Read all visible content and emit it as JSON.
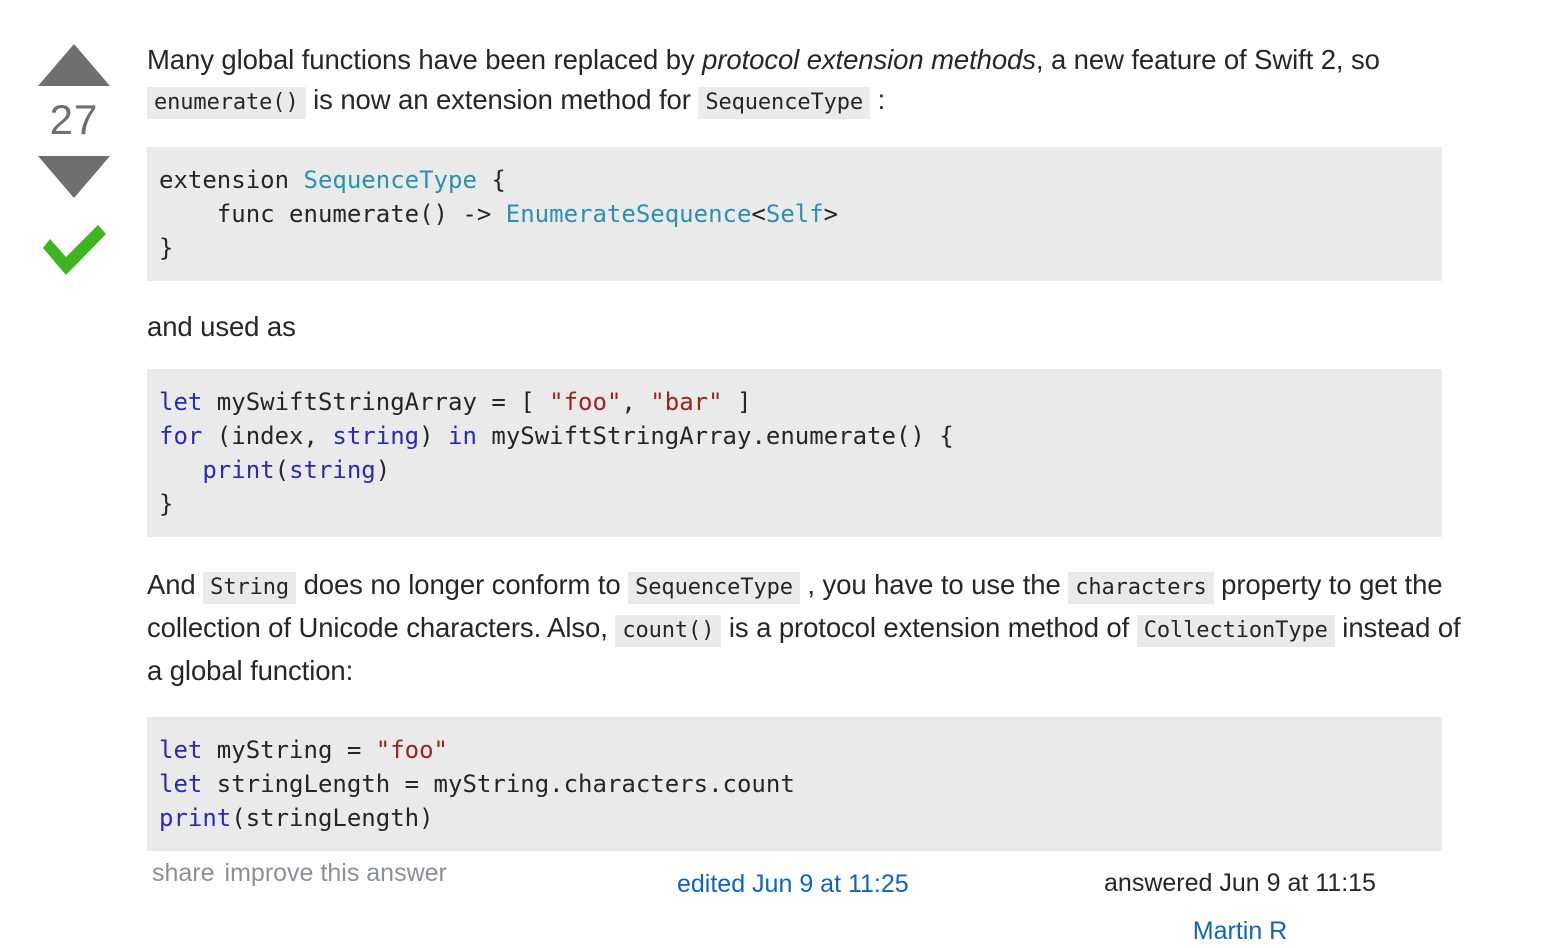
{
  "vote": {
    "upvote_icon": "triangle-up-icon",
    "count": "27",
    "downvote_icon": "triangle-down-icon",
    "accepted_icon": "checkmark-icon",
    "accepted_color": "#3cb521",
    "arrow_color": "#6d6f70"
  },
  "paragraphs": {
    "p1": {
      "s1": "Many global functions have been replaced by ",
      "em1": "protocol extension methods",
      "s2": ", a new feature of Swift 2, so ",
      "code1": "enumerate()",
      "s3": " is now an extension method for ",
      "code2": "SequenceType",
      "s4": " :"
    },
    "p2": {
      "s1": "and used as"
    },
    "p3": {
      "s1": "And ",
      "code1": "String",
      "s2": " does no longer conform to ",
      "code2": "SequenceType",
      "s3": " , you have to use the ",
      "code3": "characters",
      "s4": " property to get the collection of Unicode characters. Also, ",
      "code4": "count()",
      "s5": " is a protocol extension method of ",
      "code5": "CollectionType",
      "s6": " instead of a global function:"
    }
  },
  "code_blocks": {
    "block1": {
      "language": "swift",
      "lines": [
        [
          {
            "t": "extension ",
            "c": "plain"
          },
          {
            "t": "SequenceType",
            "c": "type"
          },
          {
            "t": " {",
            "c": "plain"
          }
        ],
        [
          {
            "t": "    func enumerate() -> ",
            "c": "plain"
          },
          {
            "t": "EnumerateSequence",
            "c": "type"
          },
          {
            "t": "<",
            "c": "plain"
          },
          {
            "t": "Self",
            "c": "type"
          },
          {
            "t": ">",
            "c": "plain"
          }
        ],
        [
          {
            "t": "}",
            "c": "plain"
          }
        ]
      ]
    },
    "block2": {
      "language": "swift",
      "lines": [
        [
          {
            "t": "let",
            "c": "kw"
          },
          {
            "t": " mySwiftStringArray = [ ",
            "c": "plain"
          },
          {
            "t": "\"foo\"",
            "c": "str"
          },
          {
            "t": ", ",
            "c": "plain"
          },
          {
            "t": "\"bar\"",
            "c": "str"
          },
          {
            "t": " ]",
            "c": "plain"
          }
        ],
        [
          {
            "t": "for",
            "c": "kw"
          },
          {
            "t": " (index, ",
            "c": "plain"
          },
          {
            "t": "string",
            "c": "kw"
          },
          {
            "t": ") ",
            "c": "plain"
          },
          {
            "t": "in",
            "c": "kw"
          },
          {
            "t": " mySwiftStringArray.enumerate() {",
            "c": "plain"
          }
        ],
        [
          {
            "t": "   ",
            "c": "plain"
          },
          {
            "t": "print",
            "c": "fn"
          },
          {
            "t": "(",
            "c": "plain"
          },
          {
            "t": "string",
            "c": "kw"
          },
          {
            "t": ")",
            "c": "plain"
          }
        ],
        [
          {
            "t": "}",
            "c": "plain"
          }
        ]
      ]
    },
    "block3": {
      "language": "swift",
      "lines": [
        [
          {
            "t": "let",
            "c": "kw"
          },
          {
            "t": " myString = ",
            "c": "plain"
          },
          {
            "t": "\"foo\"",
            "c": "str"
          }
        ],
        [
          {
            "t": "let",
            "c": "kw"
          },
          {
            "t": " stringLength = myString.characters.count",
            "c": "plain"
          }
        ],
        [
          {
            "t": "print",
            "c": "fn"
          },
          {
            "t": "(stringLength)",
            "c": "plain"
          }
        ]
      ]
    }
  },
  "footer": {
    "share_label": "share",
    "improve_label": "improve this answer",
    "edited_label": "edited Jun 9 at 11:25",
    "answered_label": "answered Jun 9 at 11:15",
    "user_name": "Martin R",
    "link_color": "#0d64c1",
    "muted_color": "#8b9096"
  }
}
